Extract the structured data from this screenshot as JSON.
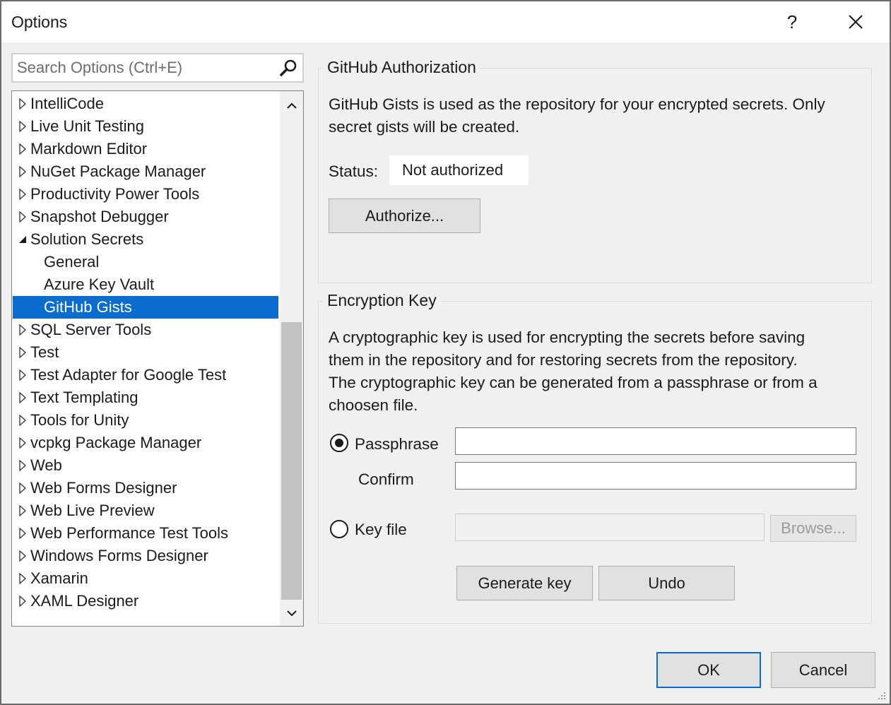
{
  "window": {
    "title": "Options",
    "help_glyph": "?",
    "close_glyph": "✕"
  },
  "search": {
    "placeholder": "Search Options (Ctrl+E)"
  },
  "tree": {
    "items": [
      {
        "label": "IntelliCode",
        "level": 0,
        "expanded": false,
        "selected": false
      },
      {
        "label": "Live Unit Testing",
        "level": 0,
        "expanded": false,
        "selected": false
      },
      {
        "label": "Markdown Editor",
        "level": 0,
        "expanded": false,
        "selected": false
      },
      {
        "label": "NuGet Package Manager",
        "level": 0,
        "expanded": false,
        "selected": false
      },
      {
        "label": "Productivity Power Tools",
        "level": 0,
        "expanded": false,
        "selected": false
      },
      {
        "label": "Snapshot Debugger",
        "level": 0,
        "expanded": false,
        "selected": false
      },
      {
        "label": "Solution Secrets",
        "level": 0,
        "expanded": true,
        "selected": false
      },
      {
        "label": "General",
        "level": 1,
        "expanded": null,
        "selected": false
      },
      {
        "label": "Azure Key Vault",
        "level": 1,
        "expanded": null,
        "selected": false
      },
      {
        "label": "GitHub Gists",
        "level": 1,
        "expanded": null,
        "selected": true
      },
      {
        "label": "SQL Server Tools",
        "level": 0,
        "expanded": false,
        "selected": false
      },
      {
        "label": "Test",
        "level": 0,
        "expanded": false,
        "selected": false
      },
      {
        "label": "Test Adapter for Google Test",
        "level": 0,
        "expanded": false,
        "selected": false
      },
      {
        "label": "Text Templating",
        "level": 0,
        "expanded": false,
        "selected": false
      },
      {
        "label": "Tools for Unity",
        "level": 0,
        "expanded": false,
        "selected": false
      },
      {
        "label": "vcpkg Package Manager",
        "level": 0,
        "expanded": false,
        "selected": false
      },
      {
        "label": "Web",
        "level": 0,
        "expanded": false,
        "selected": false
      },
      {
        "label": "Web Forms Designer",
        "level": 0,
        "expanded": false,
        "selected": false
      },
      {
        "label": "Web Live Preview",
        "level": 0,
        "expanded": false,
        "selected": false
      },
      {
        "label": "Web Performance Test Tools",
        "level": 0,
        "expanded": false,
        "selected": false
      },
      {
        "label": "Windows Forms Designer",
        "level": 0,
        "expanded": false,
        "selected": false
      },
      {
        "label": "Xamarin",
        "level": 0,
        "expanded": false,
        "selected": false
      },
      {
        "label": "XAML Designer",
        "level": 0,
        "expanded": false,
        "selected": false
      }
    ]
  },
  "github_auth": {
    "title": "GitHub Authorization",
    "description_line1": "GitHub Gists is used as the repository for your encrypted secrets. Only",
    "description_line2": "secret gists will be created.",
    "status_label": "Status:",
    "status_value": "Not authorized",
    "authorize_button": "Authorize..."
  },
  "encryption_key": {
    "title": "Encryption Key",
    "description_line1": "A cryptographic key is used for encrypting the secrets before saving",
    "description_line2": "them in the repository and for restoring secrets from the repository.",
    "description_line3": "The cryptographic key can be generated from a passphrase or from a",
    "description_line4": "choosen file.",
    "passphrase_label": "Passphrase",
    "passphrase_value": "",
    "confirm_label": "Confirm",
    "confirm_value": "",
    "keyfile_label": "Key file",
    "keyfile_value": "",
    "browse_button": "Browse...",
    "generate_button": "Generate key",
    "undo_button": "Undo",
    "selected_option": "Passphrase"
  },
  "footer": {
    "ok_button": "OK",
    "cancel_button": "Cancel"
  },
  "colors": {
    "selection": "#0a6ccf",
    "window_bg": "#f0f0f0",
    "default_button_border": "#0a6ccf"
  }
}
